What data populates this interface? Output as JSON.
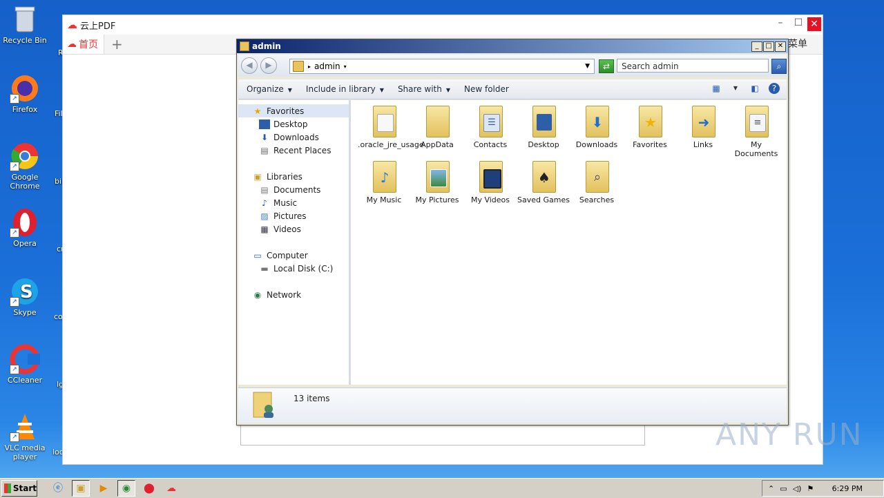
{
  "desktop": {
    "icons": [
      {
        "label": "Recycle Bin",
        "icon": "recycle-bin-icon"
      },
      {
        "label": "Firefox",
        "icon": "firefox-icon"
      },
      {
        "label": "Google Chrome",
        "icon": "chrome-icon"
      },
      {
        "label": "Opera",
        "icon": "opera-icon"
      },
      {
        "label": "Skype",
        "icon": "skype-icon"
      },
      {
        "label": "CCleaner",
        "icon": "ccleaner-icon"
      },
      {
        "label": "VLC media player",
        "icon": "vlc-icon"
      }
    ],
    "partial_labels": [
      "R",
      "Fil",
      "bil",
      "cr",
      "co",
      "lg",
      "loc"
    ]
  },
  "pdf_app": {
    "title": "云上PDF",
    "tab_label": "首页",
    "new_tab": "+",
    "menu_label": "菜单",
    "accent": "#e33333"
  },
  "explorer": {
    "title": "admin",
    "address": "admin",
    "search_placeholder": "Search admin",
    "toolbar": {
      "organize": "Organize",
      "include": "Include in library",
      "share": "Share with",
      "new_folder": "New folder"
    },
    "nav": {
      "favorites": "Favorites",
      "desktop": "Desktop",
      "downloads": "Downloads",
      "recent": "Recent Places",
      "libraries": "Libraries",
      "documents": "Documents",
      "music": "Music",
      "pictures": "Pictures",
      "videos": "Videos",
      "computer": "Computer",
      "local_disk": "Local Disk (C:)",
      "network": "Network"
    },
    "items": [
      {
        "label": ".oracle_jre_usage",
        "icon": "folder-file-icon"
      },
      {
        "label": "AppData",
        "icon": "folder-icon"
      },
      {
        "label": "Contacts",
        "icon": "folder-contacts-icon"
      },
      {
        "label": "Desktop",
        "icon": "folder-desktop-icon"
      },
      {
        "label": "Downloads",
        "icon": "folder-downloads-icon"
      },
      {
        "label": "Favorites",
        "icon": "folder-favorites-icon"
      },
      {
        "label": "Links",
        "icon": "folder-links-icon"
      },
      {
        "label": "My Documents",
        "icon": "folder-documents-icon"
      },
      {
        "label": "My Music",
        "icon": "folder-music-icon"
      },
      {
        "label": "My Pictures",
        "icon": "folder-pictures-icon"
      },
      {
        "label": "My Videos",
        "icon": "folder-videos-icon"
      },
      {
        "label": "Saved Games",
        "icon": "folder-games-icon"
      },
      {
        "label": "Searches",
        "icon": "folder-search-icon"
      }
    ],
    "status": "13 items"
  },
  "taskbar": {
    "start": "Start",
    "clock": "6:29 PM"
  },
  "watermark": "ANY RUN"
}
